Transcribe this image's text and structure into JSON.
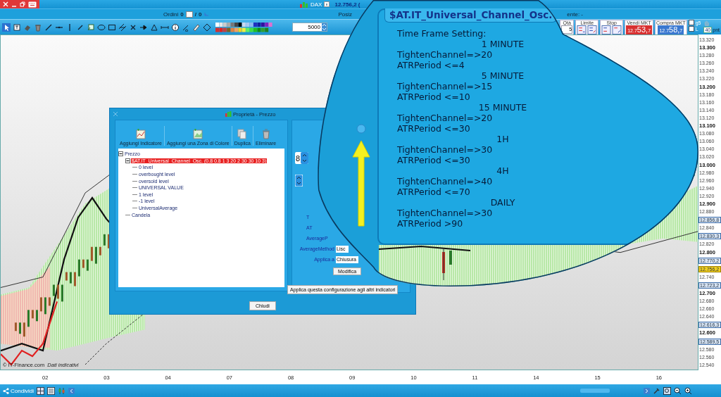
{
  "title_bar": {
    "instrument": "DAX",
    "price": "12.756,2 ("
  },
  "orders_bar": {
    "label": "Ordini",
    "orders": "0",
    "separator": "/",
    "pending": "0",
    "positions": "Posiz",
    "other": "ente: -"
  },
  "toolbar": {
    "step": "5000",
    "quantity_label": "Qtà",
    "quantity": "5",
    "limit_label": "Limite",
    "stop_label": "Stop",
    "sell": {
      "label": "Vendi MKT",
      "prefix": "12.7",
      "price": "53,",
      "tick": "7"
    },
    "buy": {
      "label": "Compra MKT",
      "prefix": "12.7",
      "price": "58,",
      "tick": "7"
    },
    "options": [
      {
        "label": "g5",
        "checked": false
      },
      {
        "label": "L",
        "checked": false
      }
    ],
    "points": "40",
    "points_unit": "pnt"
  },
  "chart": {
    "price_axis": [
      {
        "label": "13.320",
        "kind": "minor"
      },
      {
        "label": "13.300",
        "kind": "major"
      },
      {
        "label": "13.280",
        "kind": "minor"
      },
      {
        "label": "13.260",
        "kind": "minor"
      },
      {
        "label": "13.240",
        "kind": "minor"
      },
      {
        "label": "13.220",
        "kind": "minor"
      },
      {
        "label": "13.200",
        "kind": "major"
      },
      {
        "label": "13.180",
        "kind": "minor"
      },
      {
        "label": "13.160",
        "kind": "minor"
      },
      {
        "label": "13.140",
        "kind": "minor"
      },
      {
        "label": "13.120",
        "kind": "minor"
      },
      {
        "label": "13.100",
        "kind": "major"
      },
      {
        "label": "13.080",
        "kind": "minor"
      },
      {
        "label": "13.060",
        "kind": "minor"
      },
      {
        "label": "13.040",
        "kind": "minor"
      },
      {
        "label": "13.020",
        "kind": "minor"
      },
      {
        "label": "13.000",
        "kind": "major"
      },
      {
        "label": "12.980",
        "kind": "minor"
      },
      {
        "label": "12.960",
        "kind": "minor"
      },
      {
        "label": "12.940",
        "kind": "minor"
      },
      {
        "label": "12.920",
        "kind": "minor"
      },
      {
        "label": "12.900",
        "kind": "major"
      },
      {
        "label": "12.880",
        "kind": "minor"
      },
      {
        "label": "12.856,8",
        "kind": "marker"
      },
      {
        "label": "12.840",
        "kind": "minor"
      },
      {
        "label": "12.830,3",
        "kind": "marker"
      },
      {
        "label": "12.820",
        "kind": "minor"
      },
      {
        "label": "12.800",
        "kind": "major"
      },
      {
        "label": "12.770,2",
        "kind": "marker"
      },
      {
        "label": "12.756,2",
        "kind": "current"
      },
      {
        "label": "12.740",
        "kind": "minor"
      },
      {
        "label": "12.723,2",
        "kind": "marker"
      },
      {
        "label": "12.700",
        "kind": "major"
      },
      {
        "label": "12.680",
        "kind": "minor"
      },
      {
        "label": "12.660",
        "kind": "minor"
      },
      {
        "label": "12.640",
        "kind": "minor"
      },
      {
        "label": "12.616,3",
        "kind": "marker"
      },
      {
        "label": "12.600",
        "kind": "major"
      },
      {
        "label": "12.589,5",
        "kind": "marker"
      },
      {
        "label": "12.580",
        "kind": "minor"
      },
      {
        "label": "12.560",
        "kind": "minor"
      },
      {
        "label": "12.540",
        "kind": "minor"
      }
    ],
    "date_axis": [
      "02",
      "03",
      "04",
      "07",
      "08",
      "09",
      "10",
      "11",
      "14",
      "15",
      "16"
    ],
    "credit": "© IT-Finance.com",
    "credit_note": "Dati indicativi"
  },
  "dialog": {
    "title": "Proprietà - Prezzo",
    "actions": [
      "Aggiungi Indicatore",
      "Aggiungi una Zona di Colore",
      "Duplica",
      "Eliminare"
    ],
    "tree": [
      {
        "label": "Prezzo",
        "selected": false,
        "expanded": true,
        "children": [
          {
            "label": "$AT.IT_Universal_Channel_Osc. (0.8 0.8 1 3 20 2 30 30 10 3)",
            "selected": true,
            "expanded": true,
            "children": [
              {
                "label": "0 level",
                "selected": false
              },
              {
                "label": "overbought level",
                "selected": false
              },
              {
                "label": "oversold level",
                "selected": false
              },
              {
                "label": "UNIVERSAL VALUE",
                "selected": false
              },
              {
                "label": "1 level",
                "selected": false
              },
              {
                "label": "-1 level",
                "selected": false
              },
              {
                "label": "UniversalAverage",
                "selected": false
              }
            ]
          },
          {
            "label": "Candela",
            "selected": false
          }
        ]
      }
    ],
    "spinner_value": "8",
    "params": [
      {
        "label": "T",
        "kind": "partial"
      },
      {
        "label": "AT",
        "kind": "partial"
      },
      {
        "label": "AverageP",
        "kind": "partial"
      },
      {
        "label": "AverageMethod",
        "kind": "field",
        "value": "Lisc"
      },
      {
        "label": "Applica a",
        "kind": "field",
        "value": "Chiusura"
      }
    ],
    "modify": "Modifica",
    "apply_all": "Applica questa configurazione agli altri indicatori",
    "close": "Chiudi"
  },
  "magnifier": {
    "title": "$AT.IT_Universal_Channel_Osc.",
    "lines": [
      {
        "text": "Time Frame Setting:",
        "kind": "intro"
      },
      {
        "text": "1 MINUTE",
        "kind": "heading"
      },
      {
        "text": "TightenChannel=>20",
        "kind": "value"
      },
      {
        "text": "ATRPeriod <=4",
        "kind": "value"
      },
      {
        "text": "5 MINUTE",
        "kind": "heading"
      },
      {
        "text": "TightenChannel=>15",
        "kind": "value"
      },
      {
        "text": "ATRPeriod <=10",
        "kind": "value"
      },
      {
        "text": "15 MINUTE",
        "kind": "heading"
      },
      {
        "text": "TightenChannel=>20",
        "kind": "value"
      },
      {
        "text": "ATRPeriod <=30",
        "kind": "value"
      },
      {
        "text": "1H",
        "kind": "heading"
      },
      {
        "text": "TightenChannel=>30",
        "kind": "value"
      },
      {
        "text": "ATRPeriod <=30",
        "kind": "value"
      },
      {
        "text": "4H",
        "kind": "heading"
      },
      {
        "text": "TightenChannel=>40",
        "kind": "value"
      },
      {
        "text": "ATRPeriod <=70",
        "kind": "value"
      },
      {
        "text": "DAILY",
        "kind": "heading"
      },
      {
        "text": "TightenChannel=>30",
        "kind": "value"
      },
      {
        "text": "ATRPeriod >90",
        "kind": "value"
      }
    ]
  },
  "bottom_bar": {
    "share": "Condividi"
  }
}
